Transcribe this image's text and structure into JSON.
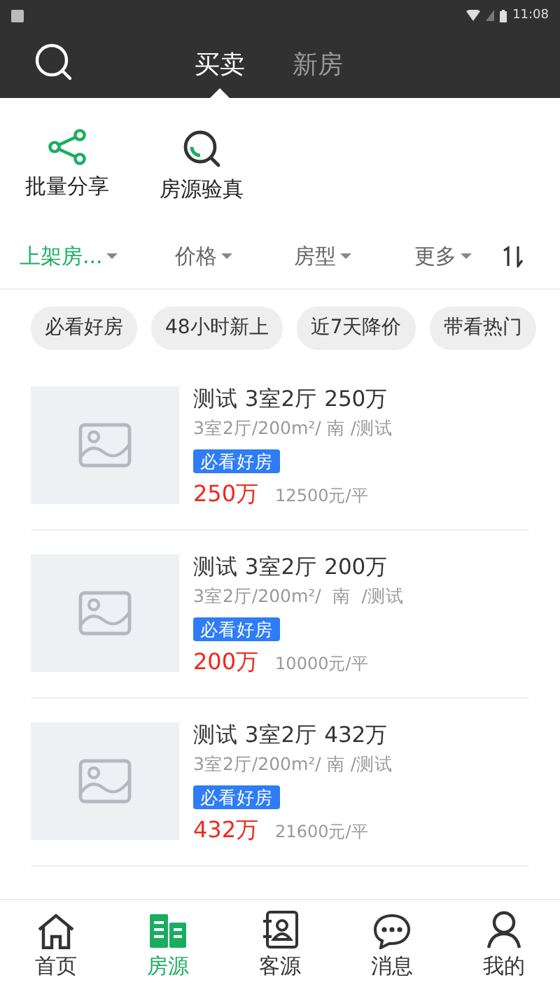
{
  "status_bar": {
    "time": "11:08"
  },
  "header": {
    "tabs": [
      {
        "label": "买卖",
        "selected": true
      },
      {
        "label": "新房",
        "selected": false
      }
    ]
  },
  "tools": [
    {
      "label": "批量分享",
      "kind": "share"
    },
    {
      "label": "房源验真",
      "kind": "verify"
    }
  ],
  "filters": [
    {
      "label": "上架房...",
      "selected": true
    },
    {
      "label": "价格",
      "selected": false
    },
    {
      "label": "房型",
      "selected": false
    },
    {
      "label": "更多",
      "selected": false
    }
  ],
  "chips": [
    "必看好房",
    "48小时新上",
    "近7天降价",
    "带看热门"
  ],
  "listings": [
    {
      "title": "测试 3室2厅 250万",
      "specs": "3室2厅/200m²/ 南 /测试",
      "tag": "必看好房",
      "price": "250万",
      "unit_price": "12500元/平"
    },
    {
      "title": "测试 3室2厅 200万",
      "specs": "3室2厅/200m²/  南  /测试",
      "tag": "必看好房",
      "price": "200万",
      "unit_price": "10000元/平"
    },
    {
      "title": "测试 3室2厅 432万",
      "specs": "3室2厅/200m²/ 南 /测试",
      "tag": "必看好房",
      "price": "432万",
      "unit_price": "21600元/平"
    }
  ],
  "nav": [
    {
      "label": "首页",
      "kind": "home",
      "selected": false
    },
    {
      "label": "房源",
      "kind": "buildings",
      "selected": true
    },
    {
      "label": "客源",
      "kind": "contacts",
      "selected": false
    },
    {
      "label": "消息",
      "kind": "chat",
      "selected": false
    },
    {
      "label": "我的",
      "kind": "user",
      "selected": false
    }
  ]
}
